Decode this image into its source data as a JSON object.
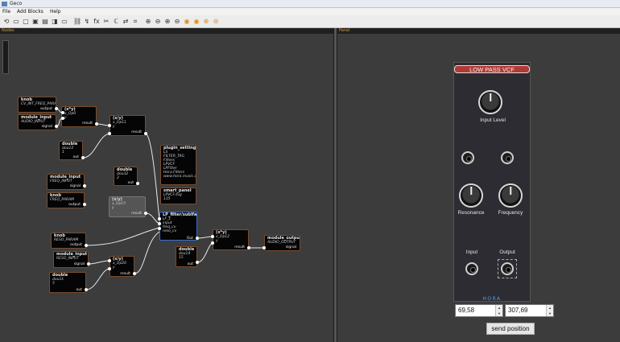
{
  "window": {
    "title": "Geco"
  },
  "menu": [
    "File",
    "Add Blocks",
    "Help"
  ],
  "toolbar": [
    "⟲",
    "▭",
    "▢",
    "▣",
    "▤",
    "◨",
    "▭",
    "⛓",
    "↯",
    "fx",
    "✂",
    "ℂ",
    "⇄",
    "⌗",
    "⊕",
    "⊖",
    "⊕",
    "⊖",
    "◉",
    "◉",
    "⊕",
    "⊖"
  ],
  "panes": {
    "nodes_title": "Nodes",
    "panel_title": "Panel"
  },
  "nodes": [
    {
      "id": "knob1",
      "name": "knob",
      "lines": [
        "CV_INT_FREQ_PARA"
      ],
      "out": "output"
    },
    {
      "id": "modin1",
      "name": "module_input",
      "lines": [
        "AUDIO_INPUT"
      ],
      "out": "signal"
    },
    {
      "id": "mul1",
      "name": "(x*y)",
      "lines": [
        "x_Op0",
        "y"
      ],
      "out": "result"
    },
    {
      "id": "div1",
      "name": "(x/y)",
      "lines": [
        "x_Op11",
        "y"
      ],
      "out": "result"
    },
    {
      "id": "dbl1",
      "name": "double",
      "lines": [
        "dou12",
        "1"
      ],
      "out": "out"
    },
    {
      "id": "plugin",
      "name": "plugin_setting",
      "lines": [
        "LS",
        "FILTER_TAG",
        "Filters",
        "LPVCF",
        "LPFilter",
        "Hora.Filters",
        "www.hora.music.c"
      ],
      "out": ""
    },
    {
      "id": "dbl2",
      "name": "double",
      "lines": [
        "dou32",
        "2"
      ],
      "out": "out"
    },
    {
      "id": "modin2",
      "name": "module_input",
      "lines": [
        "FREQ_INPUT"
      ],
      "out": "signal"
    },
    {
      "id": "knob2",
      "name": "knob",
      "lines": [
        "FREQ_PARAM"
      ],
      "out": "output"
    },
    {
      "id": "smart",
      "name": "smart_panel",
      "lines": [
        "LPVCF.svg",
        "135"
      ],
      "out": ""
    },
    {
      "id": "div2",
      "name": "(x/y)",
      "lines": [
        "x_Op15",
        "y"
      ],
      "out": "result"
    },
    {
      "id": "lp",
      "name": "LP_filter/sublfa",
      "lines": [
        "LF_1",
        "input",
        "freq_cv",
        "reso_cv"
      ],
      "out": "Out"
    },
    {
      "id": "knob3",
      "name": "knob",
      "lines": [
        "RESO_PARAM"
      ],
      "out": "output"
    },
    {
      "id": "modin3",
      "name": "module_input",
      "lines": [
        "RESO_INPUT"
      ],
      "out": "signal"
    },
    {
      "id": "mul2",
      "name": "(x*y)",
      "lines": [
        "x_Op12",
        "y"
      ],
      "out": "result"
    },
    {
      "id": "modout",
      "name": "module_output",
      "lines": [
        "AUDIO_OUTPUT"
      ],
      "out": "signal"
    },
    {
      "id": "dbl3",
      "name": "double",
      "lines": [
        "dou14",
        "15"
      ],
      "out": "out"
    },
    {
      "id": "div3",
      "name": "(x/y)",
      "lines": [
        "x_Op20",
        "y"
      ],
      "out": "result"
    },
    {
      "id": "dbl4",
      "name": "double",
      "lines": [
        "dou1k",
        "5"
      ],
      "out": "out"
    }
  ],
  "module": {
    "title": "LOW PASS VCF",
    "labels": {
      "input_level": "Input Level",
      "resonance": "Resonance",
      "frequency": "Frequency",
      "input": "Input",
      "output": "Output"
    },
    "brand": "HORA"
  },
  "position": {
    "x": "69,58",
    "y": "307,69"
  },
  "send_button": "send position",
  "colors": {
    "module_header": "#b23a35",
    "brand": "#4fa3e8",
    "node_border": "#7a4c2c",
    "accent_orange": "#d89a3a"
  }
}
